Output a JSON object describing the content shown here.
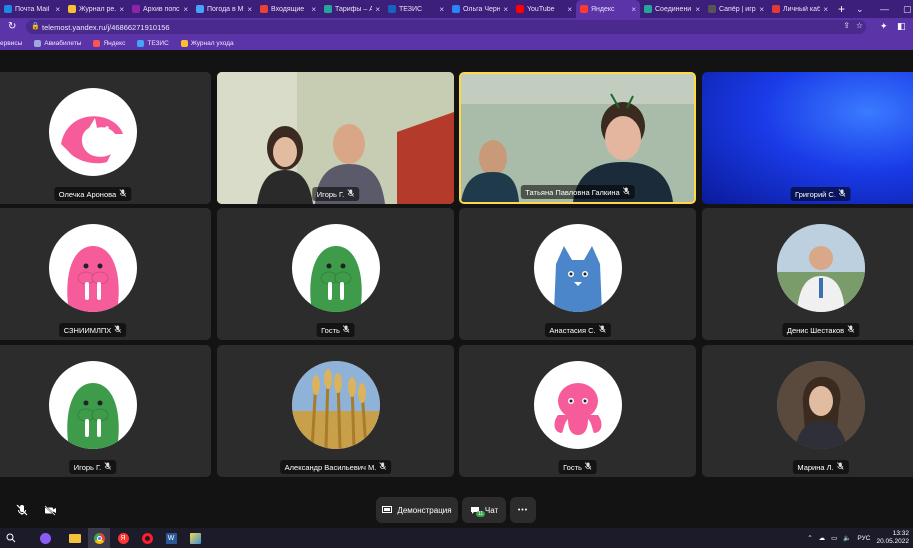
{
  "browser": {
    "tabs": [
      {
        "label": "Почта Mail",
        "color": "#1e88e5"
      },
      {
        "label": "Журнал ре...",
        "color": "#fbc02d"
      },
      {
        "label": "Архив попс",
        "color": "#8e24aa"
      },
      {
        "label": "Погода в М",
        "color": "#42a5f5"
      },
      {
        "label": "Входящие",
        "color": "#ea4335"
      },
      {
        "label": "Тарифы – А",
        "color": "#26a69a"
      },
      {
        "label": "ТЕЗИС",
        "color": "#1565c0"
      },
      {
        "label": "Ольга Черн",
        "color": "#2787f5"
      },
      {
        "label": "YouTube",
        "color": "#ff0000"
      },
      {
        "label": "Яндекс",
        "color": "#ff3b30",
        "active": true
      },
      {
        "label": "Соединени",
        "color": "#26a69a"
      },
      {
        "label": "Сапёр | игр",
        "color": "#555555"
      },
      {
        "label": "Личный каб",
        "color": "#e53935"
      }
    ],
    "url": "telemost.yandex.ru/j/46866271910156",
    "bookmarks": [
      {
        "label": "ервисы",
        "color": "#ffffff"
      },
      {
        "label": "Авиабилеты",
        "color": "#9fa8da"
      },
      {
        "label": "Яндекс",
        "color": "#ff5252"
      },
      {
        "label": "ТЕЗИС",
        "color": "#42a5f5"
      },
      {
        "label": "Журнал ухода",
        "color": "#fbc02d"
      }
    ]
  },
  "participants": [
    {
      "name": "Олечка Аронова",
      "avatar": "dolphin-icon",
      "bg": "#ffffff",
      "fg": "#f75c9a"
    },
    {
      "name": "Игорь Г.",
      "avatar": "video-frame",
      "bg": "#b7c4a0"
    },
    {
      "name": "Татьяна Павловна Галкина",
      "avatar": "video-frame",
      "bg": "#9db3a6",
      "speaking": true
    },
    {
      "name": "Григорий С.",
      "avatar": "video-blue",
      "bg": "#1e4dff"
    },
    {
      "name": "СЗНИИМЛПХ",
      "avatar": "walrus-icon",
      "bg": "#ffffff",
      "fg": "#f75c9a"
    },
    {
      "name": "Гость",
      "avatar": "walrus-icon",
      "bg": "#ffffff",
      "fg": "#3d9b4a"
    },
    {
      "name": "Анастасия С.",
      "avatar": "cat-icon",
      "bg": "#ffffff",
      "fg": "#4a86c9"
    },
    {
      "name": "Денис Шестаков",
      "avatar": "photo-man",
      "bg": "#9bb2c6"
    },
    {
      "name": "Игорь Г.",
      "avatar": "walrus-icon",
      "bg": "#ffffff",
      "fg": "#3d9b4a"
    },
    {
      "name": "Александр Васильевич М.",
      "avatar": "photo-wheat",
      "bg": "#c89b48"
    },
    {
      "name": "Гость",
      "avatar": "octopus-icon",
      "bg": "#ffffff",
      "fg": "#f75c9a"
    },
    {
      "name": "Марина Л.",
      "avatar": "photo-woman",
      "bg": "#7b6a58"
    }
  ],
  "controls": {
    "screen_share_label": "Демонстрация",
    "chat_label": "Чат",
    "chat_badge": "11",
    "more_label": "•••"
  },
  "taskbar": {
    "lang": "РУС",
    "time": "13:32",
    "date": "20.05.2022"
  }
}
